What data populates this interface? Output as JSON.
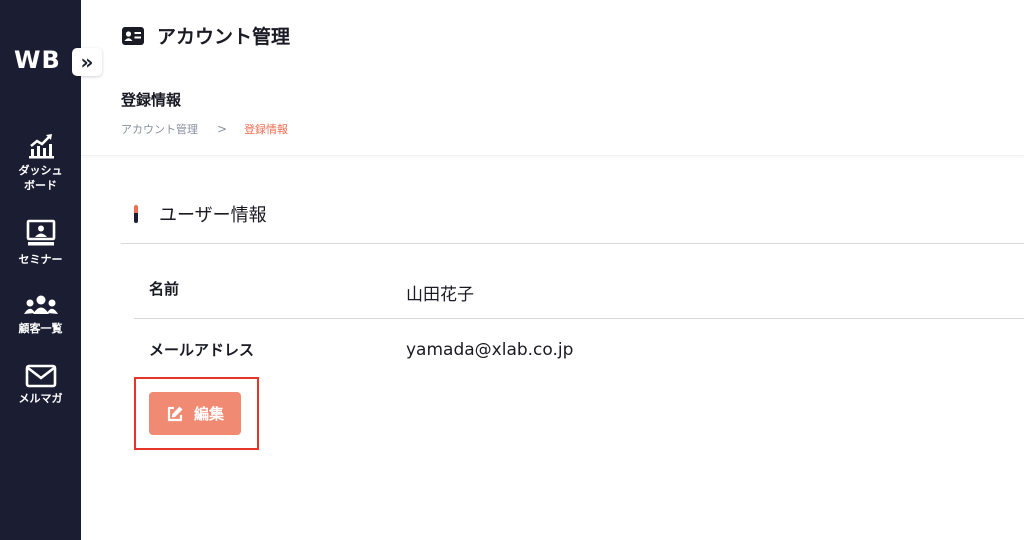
{
  "sidebar": {
    "logo": "WB",
    "items": [
      {
        "label": "ダッシュ\nボード",
        "icon": "chart-icon"
      },
      {
        "label": "セミナー",
        "icon": "seminar-icon"
      },
      {
        "label": "顧客一覧",
        "icon": "users-icon"
      },
      {
        "label": "メルマガ",
        "icon": "mail-icon"
      }
    ]
  },
  "header": {
    "title": "アカウント管理",
    "subtitle": "登録情報",
    "breadcrumb": {
      "parent": "アカウント管理",
      "separator": ">",
      "current": "登録情報"
    }
  },
  "section": {
    "title": "ユーザー情報",
    "rows": [
      {
        "label": "名前",
        "value": "山田花子"
      },
      {
        "label": "メールアドレス",
        "value": "yamada@xlab.co.jp"
      }
    ]
  },
  "edit_button": {
    "label": "編集"
  },
  "colors": {
    "sidebar_bg": "#1b1e33",
    "accent": "#ee6e52",
    "button_bg": "#f08a72",
    "highlight_border": "#e8352c"
  }
}
